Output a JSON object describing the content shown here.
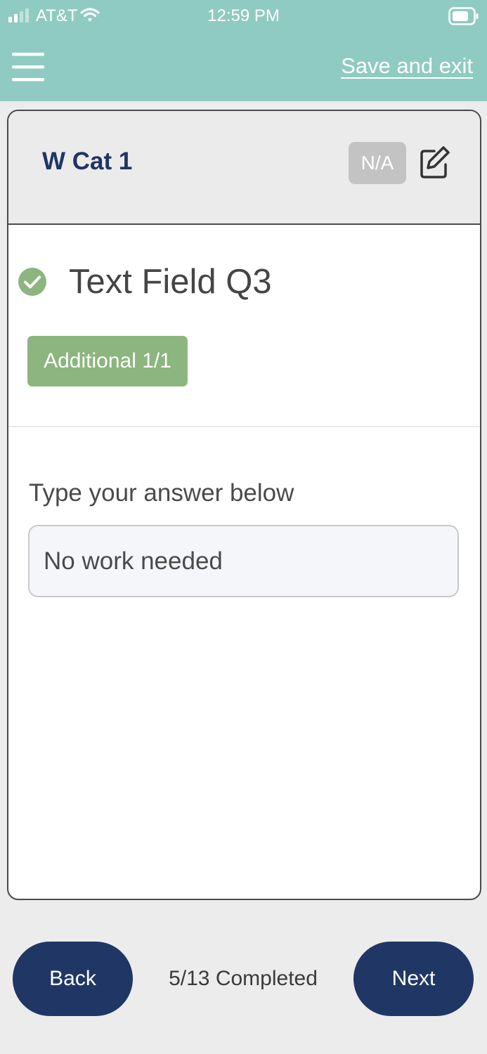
{
  "status_bar": {
    "carrier": "AT&T",
    "time": "12:59 PM",
    "signal_icon": "cellular-signal-icon",
    "wifi_icon": "wifi-icon",
    "battery_icon": "battery-icon"
  },
  "nav": {
    "menu_icon": "hamburger-menu-icon",
    "save_exit_label": "Save and exit"
  },
  "category": {
    "title": "W Cat 1",
    "na_label": "N/A",
    "edit_icon": "edit-icon"
  },
  "question": {
    "status_icon": "check-circle-icon",
    "title": "Text Field Q3",
    "additional_label": "Additional 1/1",
    "prompt": "Type your answer below",
    "answer_value": "No work needed"
  },
  "footer": {
    "back_label": "Back",
    "progress": "5/13 Completed",
    "next_label": "Next"
  },
  "colors": {
    "header_teal": "#8fcbc3",
    "primary_navy": "#203765",
    "title_navy": "#1f3563",
    "success_green": "#8db57f",
    "na_gray": "#c3c3c3"
  }
}
